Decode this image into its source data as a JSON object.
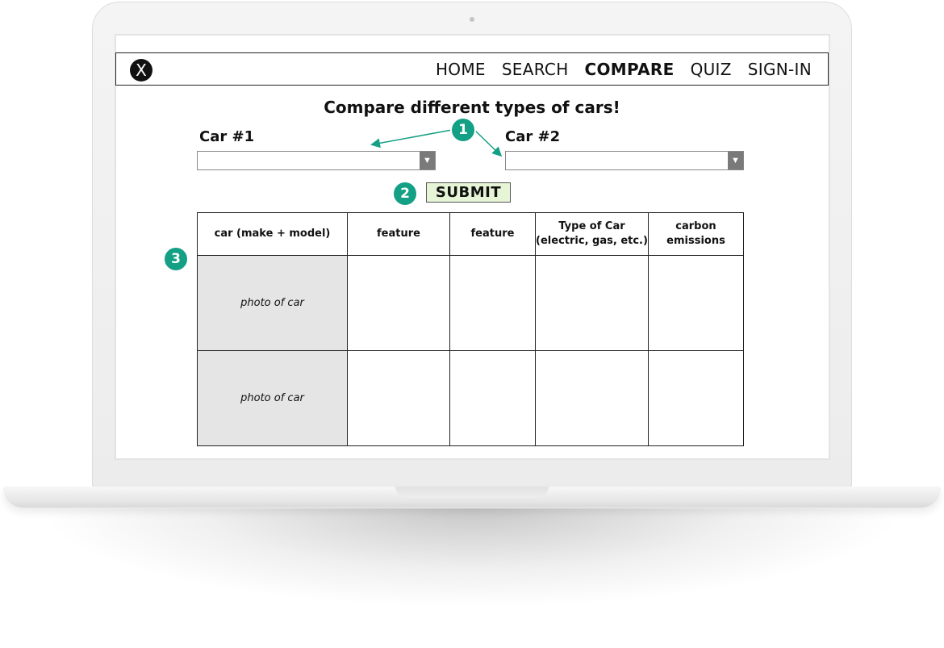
{
  "nav": {
    "logo": "X",
    "links": [
      "HOME",
      "SEARCH",
      "COMPARE",
      "QUIZ",
      "SIGN-IN"
    ],
    "active": "COMPARE"
  },
  "page": {
    "title": "Compare different types of cars!",
    "car1_label": "Car #1",
    "car2_label": "Car #2",
    "car1_value": "",
    "car2_value": "",
    "submit_label": "SUBMIT"
  },
  "annotations": [
    "1",
    "2",
    "3"
  ],
  "table": {
    "headers": [
      "car (make + model)",
      "feature",
      "feature",
      "Type of Car\n(electric, gas, etc.)",
      "carbon\nemissions"
    ],
    "rows": [
      [
        "photo of car",
        "",
        "",
        "",
        ""
      ],
      [
        "photo of car",
        "",
        "",
        "",
        ""
      ]
    ]
  },
  "colors": {
    "accent": "#14a085",
    "submit_bg": "#e6f5d6",
    "photo_bg": "#e5e5e5"
  }
}
